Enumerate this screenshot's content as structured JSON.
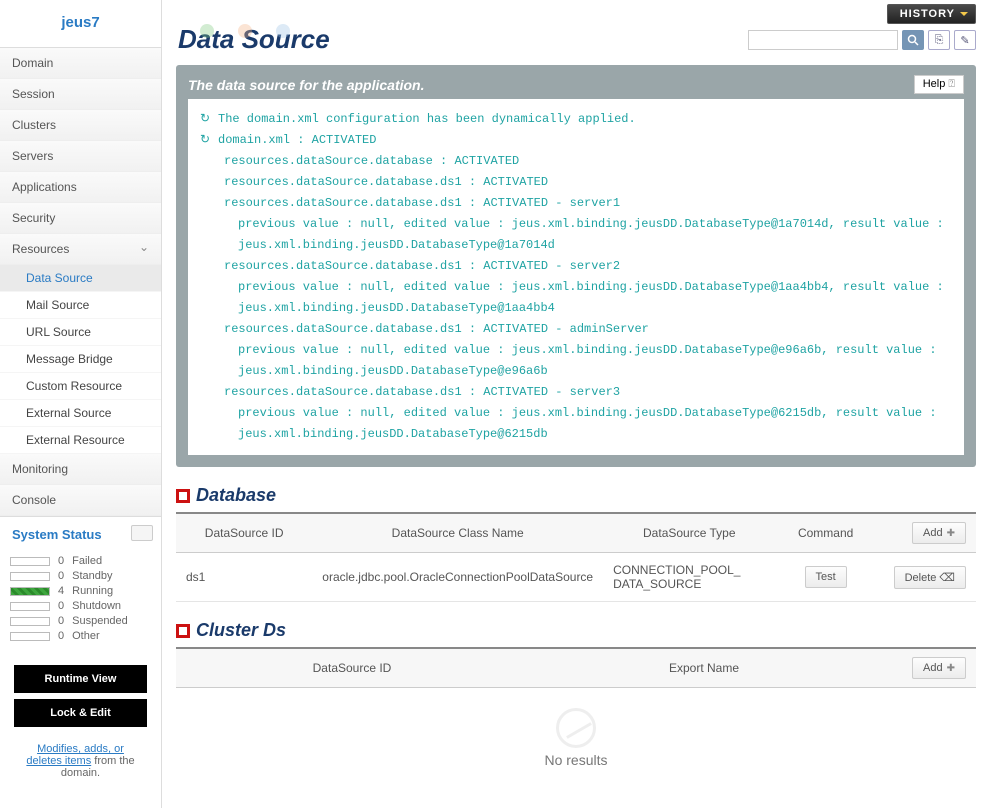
{
  "brand": "jeus7",
  "nav": {
    "domain": "Domain",
    "session": "Session",
    "clusters": "Clusters",
    "servers": "Servers",
    "applications": "Applications",
    "security": "Security",
    "resources": "Resources",
    "monitoring": "Monitoring",
    "console": "Console"
  },
  "resources_sub": {
    "data_source": "Data Source",
    "mail_source": "Mail Source",
    "url_source": "URL Source",
    "message_bridge": "Message Bridge",
    "custom_resource": "Custom Resource",
    "external_source": "External Source",
    "external_resource": "External Resource"
  },
  "system_status": {
    "title": "System Status",
    "items": [
      {
        "count": 0,
        "label": "Failed",
        "green": false
      },
      {
        "count": 0,
        "label": "Standby",
        "green": false
      },
      {
        "count": 4,
        "label": "Running",
        "green": true
      },
      {
        "count": 0,
        "label": "Shutdown",
        "green": false
      },
      {
        "count": 0,
        "label": "Suspended",
        "green": false
      },
      {
        "count": 0,
        "label": "Other",
        "green": false
      }
    ]
  },
  "sidebar_buttons": {
    "runtime_view": "Runtime View",
    "lock_edit": "Lock & Edit"
  },
  "modify_note": {
    "link": "Modifies, adds, or deletes items",
    "rest": " from the domain."
  },
  "topbar": {
    "history": "HISTORY"
  },
  "search": {
    "placeholder": ""
  },
  "page_title": "Data Source",
  "info_panel": {
    "header": "The data source for the application.",
    "help": "Help"
  },
  "log_lines": [
    {
      "icon": true,
      "indent": 0,
      "text": "The domain.xml configuration has been dynamically applied."
    },
    {
      "icon": true,
      "indent": 0,
      "text": "domain.xml : ACTIVATED"
    },
    {
      "icon": false,
      "indent": 1,
      "text": "resources.dataSource.database : ACTIVATED"
    },
    {
      "icon": false,
      "indent": 1,
      "text": "resources.dataSource.database.ds1 : ACTIVATED"
    },
    {
      "icon": false,
      "indent": 1,
      "text": "resources.dataSource.database.ds1 : ACTIVATED - server1"
    },
    {
      "icon": false,
      "indent": 2,
      "text": "previous value : null, edited value : jeus.xml.binding.jeusDD.DatabaseType@1a7014d, result value : jeus.xml.binding.jeusDD.DatabaseType@1a7014d"
    },
    {
      "icon": false,
      "indent": 1,
      "text": "resources.dataSource.database.ds1 : ACTIVATED - server2"
    },
    {
      "icon": false,
      "indent": 2,
      "text": "previous value : null, edited value : jeus.xml.binding.jeusDD.DatabaseType@1aa4bb4, result value : jeus.xml.binding.jeusDD.DatabaseType@1aa4bb4"
    },
    {
      "icon": false,
      "indent": 1,
      "text": "resources.dataSource.database.ds1 : ACTIVATED - adminServer"
    },
    {
      "icon": false,
      "indent": 2,
      "text": "previous value : null, edited value : jeus.xml.binding.jeusDD.DatabaseType@e96a6b, result value : jeus.xml.binding.jeusDD.DatabaseType@e96a6b"
    },
    {
      "icon": false,
      "indent": 1,
      "text": "resources.dataSource.database.ds1 : ACTIVATED - server3"
    },
    {
      "icon": false,
      "indent": 2,
      "text": "previous value : null, edited value : jeus.xml.binding.jeusDD.DatabaseType@6215db, result value : jeus.xml.binding.jeusDD.DatabaseType@6215db"
    }
  ],
  "database_section": {
    "title": "Database",
    "headers": {
      "id": "DataSource ID",
      "cls": "DataSource Class Name",
      "type": "DataSource Type",
      "cmd": "Command"
    },
    "add": "Add",
    "rows": [
      {
        "id": "ds1",
        "cls": "oracle.jdbc.pool.OracleConnectionPoolDataSource",
        "type": "CONNECTION_POOL_DATA_SOURCE",
        "cmd": "Test",
        "del": "Delete"
      }
    ]
  },
  "cluster_section": {
    "title": "Cluster Ds",
    "headers": {
      "id": "DataSource ID",
      "export": "Export Name"
    },
    "add": "Add",
    "no_results": "No results"
  }
}
